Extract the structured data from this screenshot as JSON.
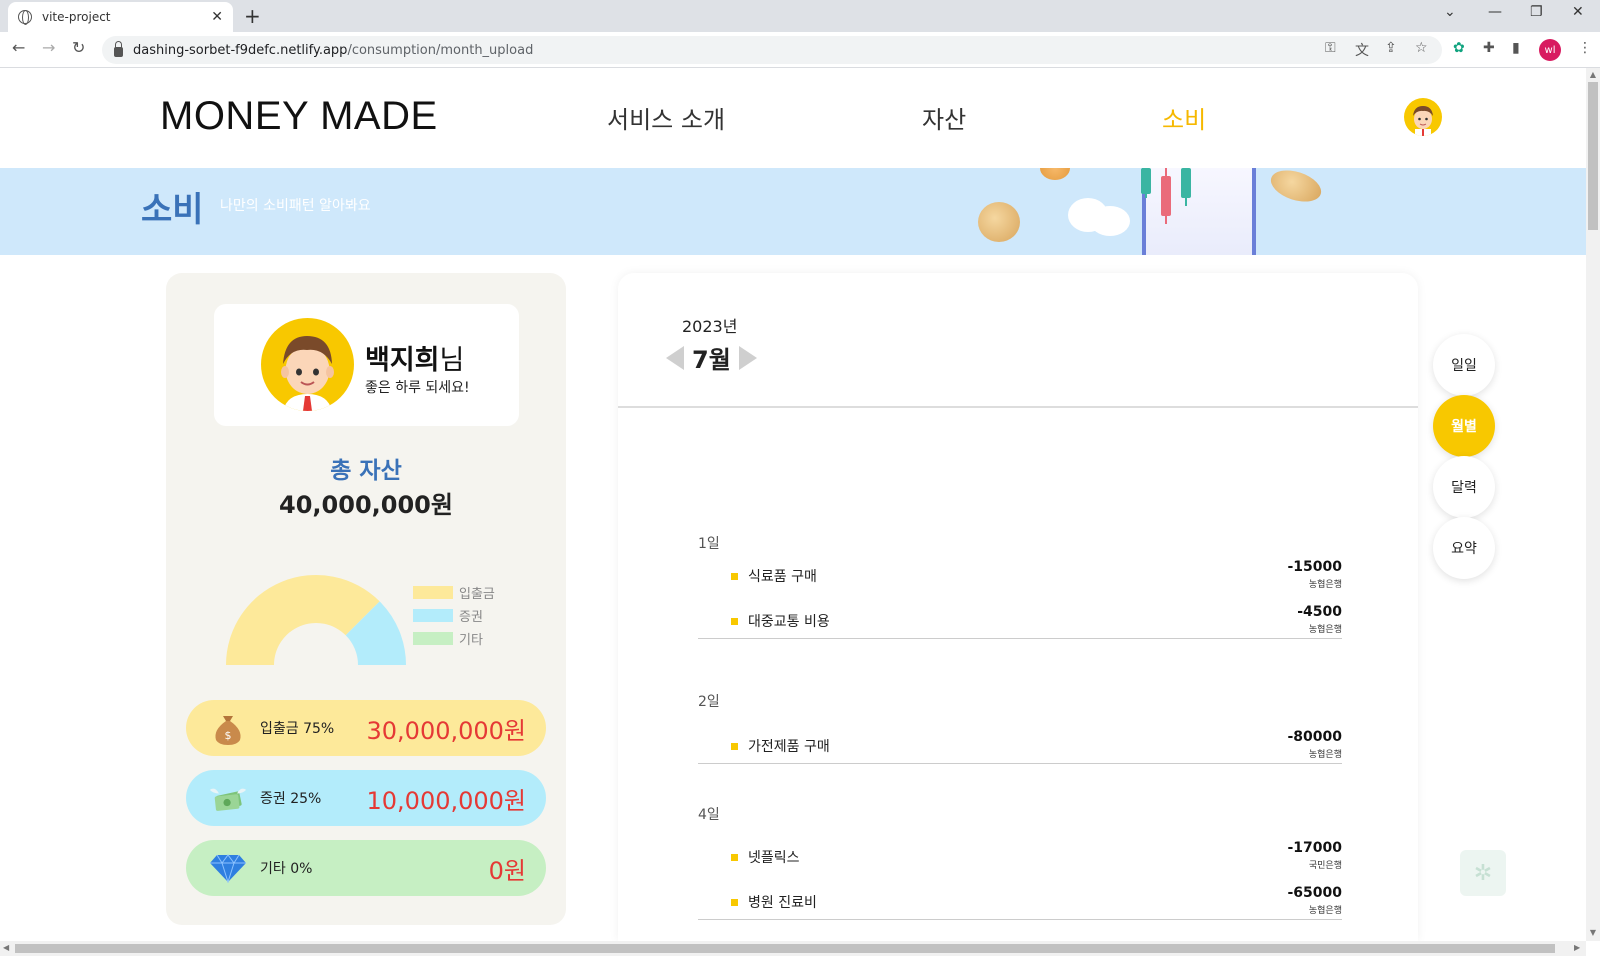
{
  "browser": {
    "tab_title": "vite-project",
    "tab_close": "✕",
    "new_tab": "+",
    "url_host": "dashing-sorbet-f9defc.netlify.app",
    "url_path": "/consumption/month_upload",
    "profile_initials": "wl"
  },
  "header": {
    "logo": "MONEY MADE",
    "nav": [
      "서비스 소개",
      "자산",
      "소비"
    ],
    "active_nav": "소비"
  },
  "banner": {
    "title": "소비",
    "subtitle": "나만의 소비패턴 알아봐요"
  },
  "profile": {
    "name": "백지희",
    "name_suffix": "님",
    "greeting": "좋은 하루 되세요!"
  },
  "total_assets": {
    "label": "총 자산",
    "value": "40,000,000원"
  },
  "chart_data": {
    "type": "pie",
    "categories": [
      "입출금",
      "증권",
      "기타"
    ],
    "values": [
      75,
      25,
      0
    ],
    "colors": [
      "#fde99a",
      "#b3ecfb",
      "#c6efc3"
    ],
    "legend_position": "right"
  },
  "asset_pills": [
    {
      "label": "입출금 75%",
      "value": "30,000,000원",
      "bg": "#fde99a",
      "icon": "money-bag-icon"
    },
    {
      "label": "증권 25%",
      "value": "10,000,000원",
      "bg": "#b3ecfb",
      "icon": "cash-wings-icon"
    },
    {
      "label": "기타 0%",
      "value": "0원",
      "bg": "#c6efc3",
      "icon": "diamond-icon"
    }
  ],
  "calendar": {
    "year": "2023년",
    "month": "7월"
  },
  "days": [
    {
      "label": "1일",
      "items": [
        {
          "name": "식료품 구매",
          "amount": "-15000",
          "bank": "농협은행"
        },
        {
          "name": "대중교통 비용",
          "amount": "-4500",
          "bank": "농협은행"
        }
      ]
    },
    {
      "label": "2일",
      "items": [
        {
          "name": "가전제품 구매",
          "amount": "-80000",
          "bank": "농협은행"
        }
      ]
    },
    {
      "label": "4일",
      "items": [
        {
          "name": "넷플릭스",
          "amount": "-17000",
          "bank": "국민은행"
        },
        {
          "name": "병원 진료비",
          "amount": "-65000",
          "bank": "농협은행"
        }
      ]
    }
  ],
  "view_toggle": {
    "options": [
      "일일",
      "월별",
      "달력",
      "요약"
    ],
    "active": "월별"
  },
  "colors": {
    "accent": "#f8c800",
    "brand_blue": "#3a72b8",
    "amount_red": "#e53935"
  }
}
